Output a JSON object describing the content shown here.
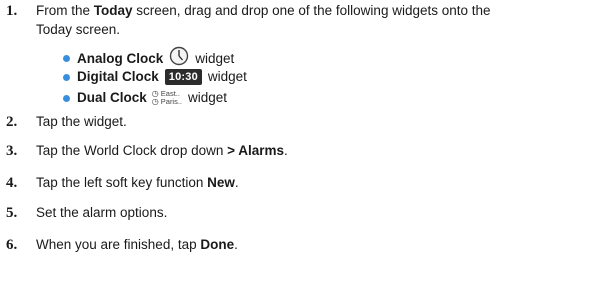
{
  "steps": [
    {
      "num": "1.",
      "line1_pre": "From the ",
      "line1_bold": "Today",
      "line1_post": " screen, drag and drop one of the following widgets onto the",
      "line2": "Today screen."
    },
    {
      "num": "2.",
      "pre": "Tap the widget.",
      "bold": "",
      "post": ""
    },
    {
      "num": "3.",
      "pre": "Tap the World Clock drop down ",
      "bold": "> Alarms",
      "post": "."
    },
    {
      "num": "4.",
      "pre": "Tap the left soft key function ",
      "bold": "New",
      "post": "."
    },
    {
      "num": "5.",
      "pre": "Set the alarm options.",
      "bold": "",
      "post": ""
    },
    {
      "num": "6.",
      "pre": "When you are finished, tap ",
      "bold": "Done",
      "post": "."
    }
  ],
  "widgets": [
    {
      "name": "Analog Clock",
      "suffix": "widget",
      "icon": "analog-clock-icon"
    },
    {
      "name": "Digital Clock",
      "suffix": "widget",
      "icon": "digital-clock-icon",
      "display": "10:30"
    },
    {
      "name": "Dual Clock",
      "suffix": "widget",
      "icon": "dual-clock-icon",
      "city1": "East..",
      "city2": "Paris.."
    }
  ],
  "colors": {
    "bullet": "#3a8fdc",
    "text": "#1a1a1a",
    "digital_bg": "#2c2c2c"
  }
}
